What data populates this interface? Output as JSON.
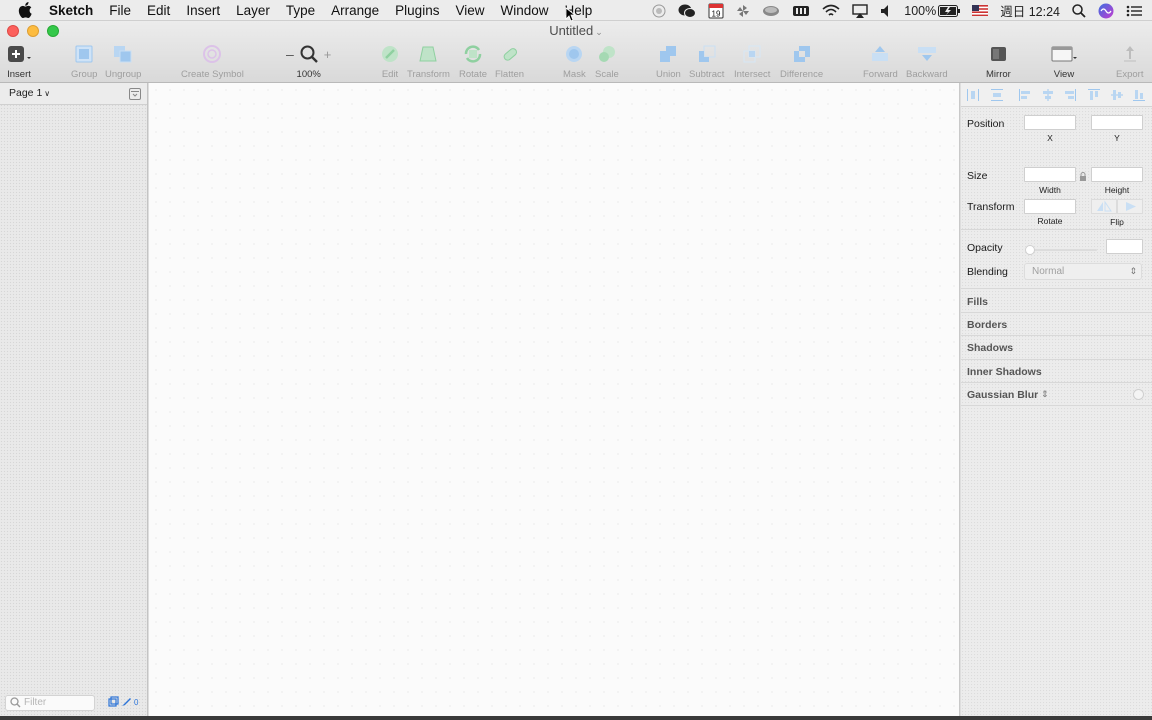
{
  "menubar": {
    "app_name": "Sketch",
    "items": [
      "File",
      "Edit",
      "Insert",
      "Layer",
      "Type",
      "Arrange",
      "Plugins",
      "View",
      "Window",
      "Help"
    ],
    "battery": "100%",
    "calendar_day": "19",
    "clock": "週日 12:24"
  },
  "window": {
    "title": "Untitled"
  },
  "toolbar": {
    "insert": "Insert",
    "group": "Group",
    "ungroup": "Ungroup",
    "create_symbol": "Create Symbol",
    "zoom_minus": "–",
    "zoom_plus": "+",
    "zoom_level": "100%",
    "edit": "Edit",
    "transform": "Transform",
    "rotate": "Rotate",
    "flatten": "Flatten",
    "mask": "Mask",
    "scale": "Scale",
    "union": "Union",
    "subtract": "Subtract",
    "intersect": "Intersect",
    "difference": "Difference",
    "forward": "Forward",
    "backward": "Backward",
    "mirror": "Mirror",
    "view": "View",
    "export": "Export"
  },
  "sidebar": {
    "page_name": "Page 1",
    "filter_placeholder": "Filter",
    "layer_count": "0"
  },
  "inspector": {
    "position_label": "Position",
    "x_label": "X",
    "y_label": "Y",
    "size_label": "Size",
    "width_label": "Width",
    "height_label": "Height",
    "transform_label": "Transform",
    "rotate_label": "Rotate",
    "flip_label": "Flip",
    "opacity_label": "Opacity",
    "blending_label": "Blending",
    "blending_value": "Normal",
    "fills": "Fills",
    "borders": "Borders",
    "shadows": "Shadows",
    "inner_shadows": "Inner Shadows",
    "gaussian_blur": "Gaussian Blur"
  },
  "colors": {
    "accent_blue": "#2c74d8",
    "disabled_green": "#8fd0a0",
    "disabled_blue": "#9fc7ee",
    "close": "#fc605c",
    "minimize": "#fdbc40",
    "maximize": "#34c84a"
  }
}
